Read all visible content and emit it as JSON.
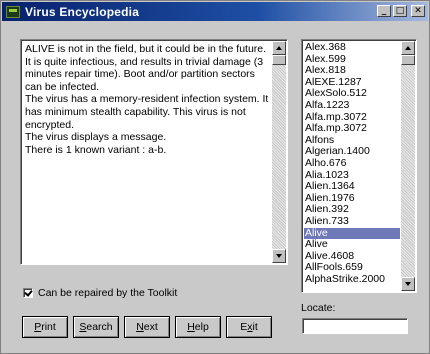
{
  "window": {
    "title": "Virus Encyclopedia",
    "buttons": {
      "minimize": "_",
      "maximize": "□",
      "close": "✕"
    }
  },
  "description": {
    "text": "ALIVE is not in the field, but it could be in the future. It is quite infectious, and results in trivial damage (3 minutes repair time). Boot and/or partition sectors can be infected.\nThe virus has a memory-resident infection system. It has minimum stealth capability. This virus is not encrypted.\nThe virus displays a message.\nThere is 1 known variant : a-b."
  },
  "virus_list": {
    "items": [
      "Alex.368",
      "Alex.599",
      "Alex.818",
      "AlEXE.1287",
      "AlexSolo.512",
      "Alfa.1223",
      "Alfa.mp.3072",
      "Alfa.mp.3072",
      "Alfons",
      "Algerian.1400",
      "Alho.676",
      "Alia.1023",
      "Alien.1364",
      "Alien.1976",
      "Alien.392",
      "Alien.733",
      "Alive",
      "Alive",
      "Alive.4608",
      "AllFools.659",
      "AlphaStrike.2000"
    ],
    "selected_index": 16
  },
  "repair_checkbox": {
    "label": "Can be repaired by the Toolkit",
    "checked": true
  },
  "locate": {
    "label": "Locate:",
    "value": ""
  },
  "buttons": [
    {
      "name": "print-button",
      "mnemonic": "P",
      "rest": "rint"
    },
    {
      "name": "search-button",
      "mnemonic": "S",
      "rest": "earch"
    },
    {
      "name": "next-button",
      "mnemonic": "N",
      "rest": "ext"
    },
    {
      "name": "help-button",
      "mnemonic": "H",
      "rest": "elp"
    },
    {
      "name": "exit-button",
      "pre": "E",
      "mnemonic": "x",
      "rest": "it"
    }
  ]
}
